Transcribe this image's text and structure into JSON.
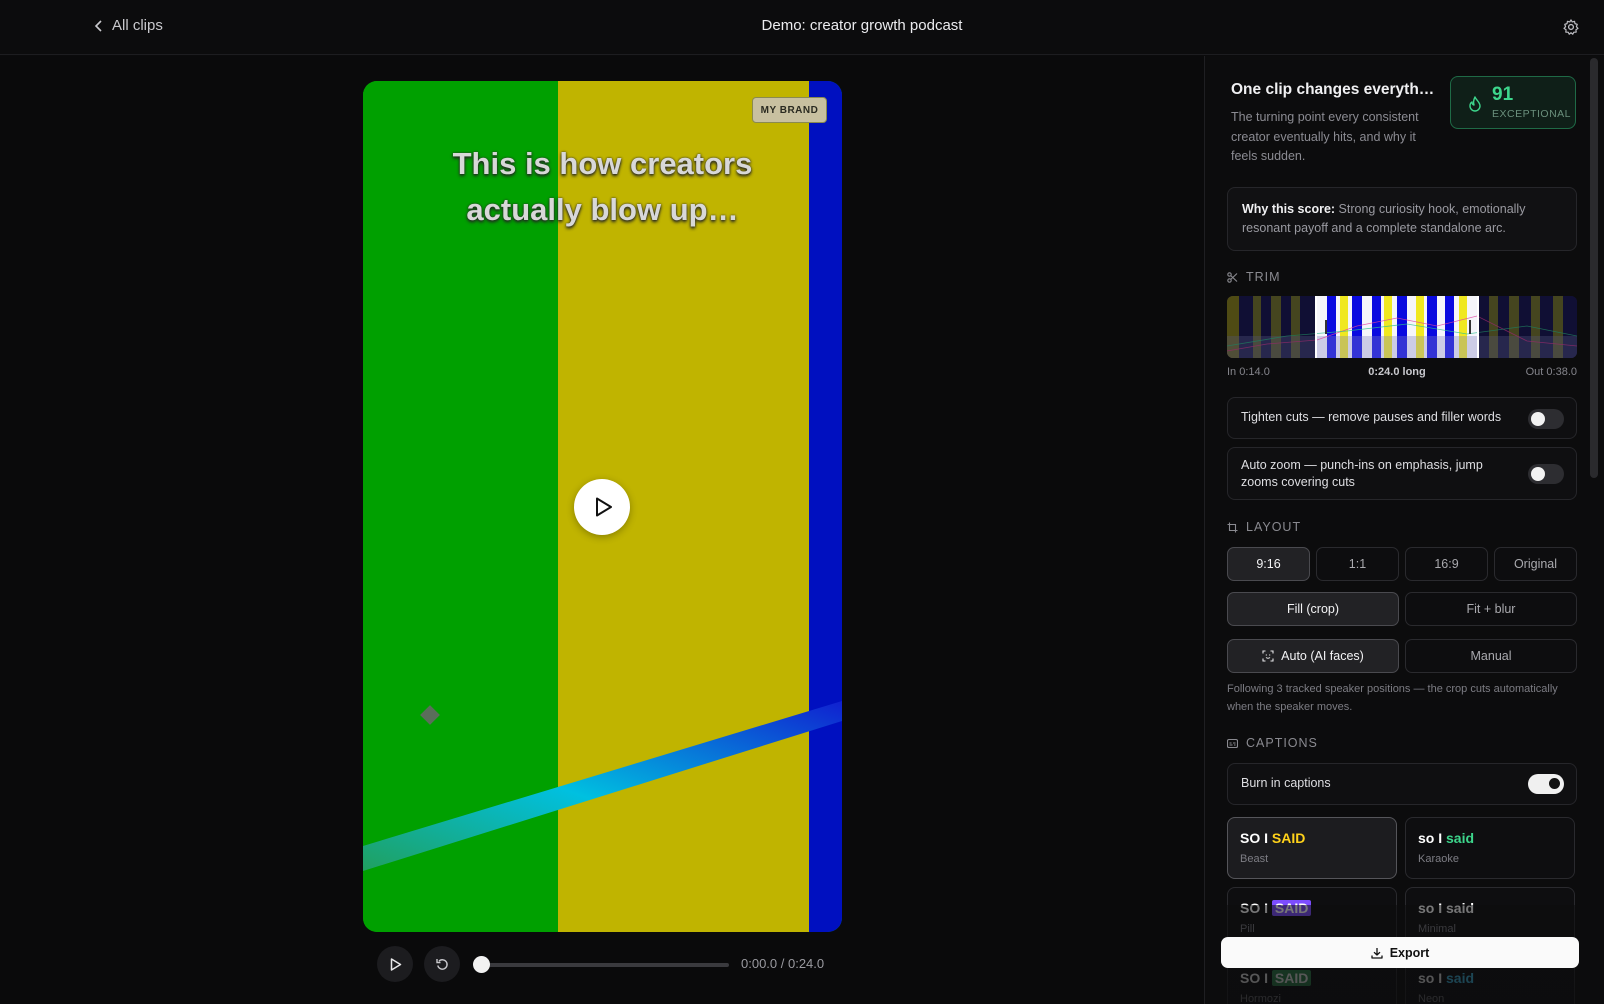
{
  "topbar": {
    "back_label": "All clips",
    "title": "Demo: creator growth podcast"
  },
  "player": {
    "brand_badge": "MY BRAND",
    "caption_line1": "This is how creators",
    "caption_line2": "actually blow up…",
    "time_display": "0:00.0 / 0:24.0",
    "progress": 0
  },
  "clip": {
    "title": "One clip changes everyth…",
    "description": "The turning point every consistent creator eventually hits, and why it feels sudden.",
    "score": "91",
    "score_label": "EXCEPTIONAL",
    "why_label": "Why this score:",
    "why_text": " Strong curiosity hook, emotionally resonant payoff and a complete standalone arc."
  },
  "trim": {
    "section_label": "TRIM",
    "in_label": "In 0:14.0",
    "length_label": "0:24.0 long",
    "out_label": "Out 0:38.0"
  },
  "options": {
    "tighten_cuts": {
      "label": "Tighten cuts — remove pauses and filler words",
      "enabled": false
    },
    "auto_zoom": {
      "label": "Auto zoom — punch-ins on emphasis, jump zooms covering cuts",
      "enabled": false
    }
  },
  "layout": {
    "section_label": "LAYOUT",
    "ratios": [
      "9:16",
      "1:1",
      "16:9",
      "Original"
    ],
    "selected_ratio": "9:16",
    "fill_modes": [
      "Fill (crop)",
      "Fit + blur"
    ],
    "selected_fill": "Fill (crop)",
    "tracking_modes": [
      "Auto (AI faces)",
      "Manual"
    ],
    "selected_tracking": "Auto (AI faces)",
    "note": "Following 3 tracked speaker positions — the crop cuts automatically when the speaker moves."
  },
  "captions": {
    "section_label": "CAPTIONS",
    "burn_in_label": "Burn in captions",
    "burn_in": true,
    "styles": [
      {
        "word1": "SO I ",
        "word2": "SAID",
        "name": "Beast"
      },
      {
        "word1": "so I ",
        "word2": "said",
        "name": "Karaoke"
      },
      {
        "word1": "SO I ",
        "word2": "SAID",
        "name": "Pill"
      },
      {
        "word1": "so I said",
        "word2": "",
        "name": "Minimal"
      },
      {
        "word1": "SO I ",
        "word2": "SAID",
        "name": "Hormozi"
      },
      {
        "word1": "so I ",
        "word2": "said",
        "name": "Neon"
      }
    ],
    "selected_style": "Beast"
  },
  "export_label": "Export"
}
